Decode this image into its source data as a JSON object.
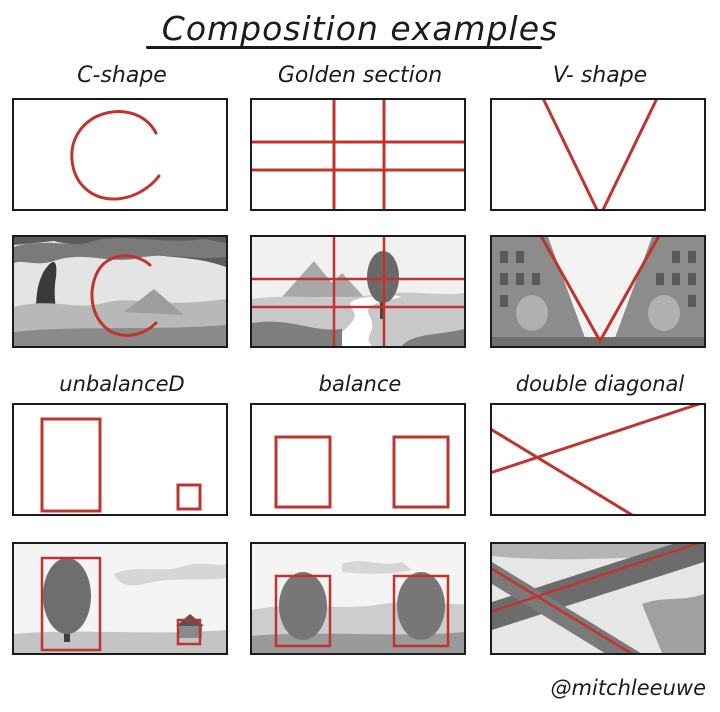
{
  "title": "Composition examples",
  "labels": {
    "c_shape": "C-shape",
    "golden_section": "Golden section",
    "v_shape": "V- shape",
    "unbalanced": "unbalanceD",
    "balance": "balance",
    "double_diagonal": "double diagonal"
  },
  "credit": "@mitchleeuwe",
  "colors": {
    "guide_red": "#c0342f",
    "ink": "#1b1b1b",
    "sketch_gray": "#9a9a9a",
    "paper": "#ffffff"
  }
}
